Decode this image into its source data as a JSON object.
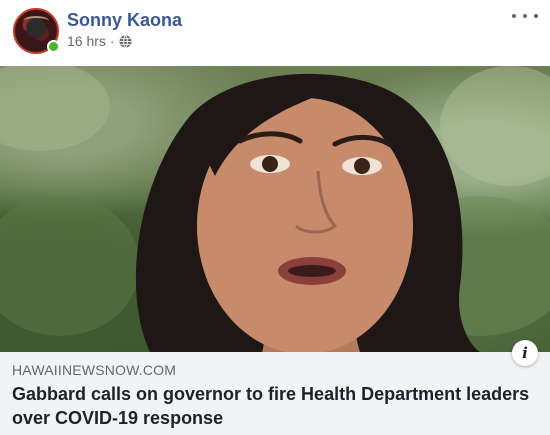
{
  "post": {
    "author_name": "Sonny Kaona",
    "timestamp": "16 hrs",
    "separator": "·",
    "privacy_icon": "globe-icon",
    "more_icon": "more-options-icon"
  },
  "link_preview": {
    "domain": "HAWAIINEWSNOW.COM",
    "title": "Gabbard calls on governor to fire Health Department leaders over COVID-19 response",
    "info_icon": "info-icon",
    "info_glyph": "i"
  },
  "colors": {
    "author_link": "#385898",
    "meta_text": "#616770",
    "link_footer_bg": "#f2f3f5",
    "title_text": "#1d2129",
    "online_dot": "#42b72a"
  }
}
